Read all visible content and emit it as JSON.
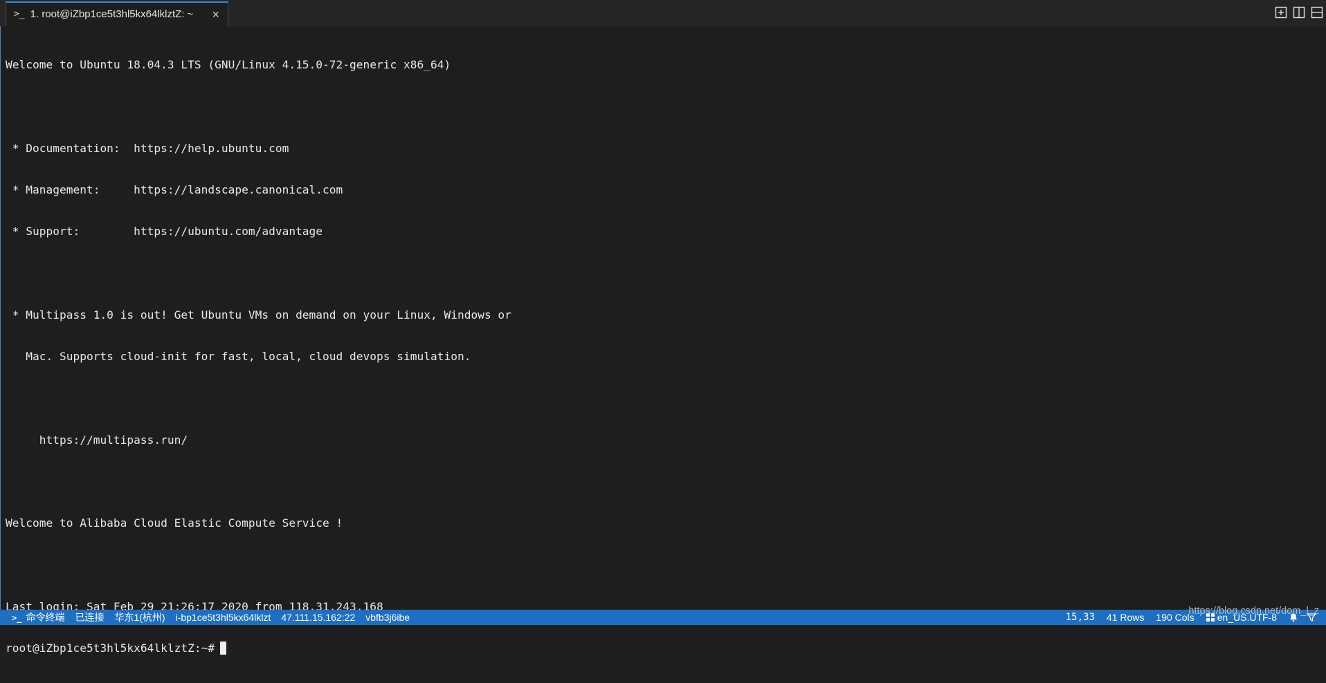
{
  "tab": {
    "icon": "terminal-prompt-icon",
    "glyph": ">_",
    "title": "1. root@iZbp1ce5t3hl5kx64lklztZ: ~",
    "close": "×"
  },
  "window_actions": [
    "add-tab-icon",
    "split-vertical-icon",
    "split-horizontal-icon"
  ],
  "terminal": {
    "lines": [
      "Welcome to Ubuntu 18.04.3 LTS (GNU/Linux 4.15.0-72-generic x86_64)",
      "",
      " * Documentation:  https://help.ubuntu.com",
      " * Management:     https://landscape.canonical.com",
      " * Support:        https://ubuntu.com/advantage",
      "",
      " * Multipass 1.0 is out! Get Ubuntu VMs on demand on your Linux, Windows or",
      "   Mac. Supports cloud-init for fast, local, cloud devops simulation.",
      "",
      "     https://multipass.run/",
      "",
      "Welcome to Alibaba Cloud Elastic Compute Service !",
      "",
      "Last login: Sat Feb 29 21:26:17 2020 from 118.31.243.168"
    ],
    "prompt": "root@iZbp1ce5t3hl5kx64lklztZ:~#"
  },
  "status": {
    "terminal_label": "命令终端",
    "connection": "已连接",
    "region": "华东1(杭州)",
    "instance_id": "i-bp1ce5t3hl5kx64lklzt",
    "ip": "47.111.15.162:22",
    "session": "vbfb3j6ibe",
    "cursor_pos": "15,33",
    "rows": "41 Rows",
    "cols": "190 Cols",
    "encoding": "en_US.UTF-8"
  },
  "watermark": "https://blog.csdn.net/dom_l_z",
  "colors": {
    "background": "#1e1e1e",
    "statusbar": "#1e6fc2",
    "accent": "#3a8ad0",
    "text": "#e8e8e8"
  }
}
